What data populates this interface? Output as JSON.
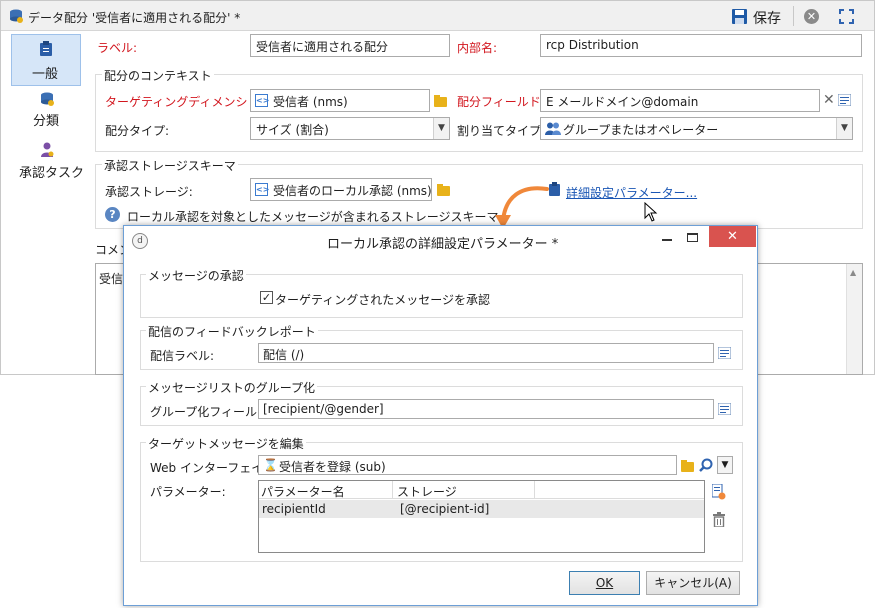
{
  "window": {
    "title": "データ配分 '受信者に適用される配分' *",
    "save_label": "保存",
    "close_icon": "close-circle-icon",
    "fullscreen_icon": "expand-icon"
  },
  "sidebar": {
    "items": [
      {
        "label": "一般",
        "icon": "clipboard-icon",
        "selected": true
      },
      {
        "label": "分類",
        "icon": "database-icon",
        "selected": false
      },
      {
        "label": "承認タスク",
        "icon": "person-icon",
        "selected": false
      }
    ]
  },
  "general": {
    "label_caption": "ラベル:",
    "label_value": "受信者に適用される配分",
    "internal_name_caption": "内部名:",
    "internal_name_value": "rcp Distribution"
  },
  "context": {
    "section_title": "配分のコンテキスト",
    "targeting_caption": "ターゲティングディメンション:",
    "targeting_value": "受信者 (nms)",
    "field_caption": "配分フィールド:",
    "field_value": "E メールドメイン@domain",
    "type_caption": "配分タイプ:",
    "type_value": "サイズ (割合)",
    "assignment_caption": "割り当てタイプ:",
    "assignment_value": "グループまたはオペレーター"
  },
  "storage": {
    "section_title": "承認ストレージスキーマ",
    "storage_caption": "承認ストレージ:",
    "storage_value": "受信者のローカル承認 (nms)",
    "advanced_link": "詳細設定パラメーター...",
    "help_text": "ローカル承認を対象としたメッセージが含まれるストレージスキーマ"
  },
  "comment": {
    "caption": "コメン",
    "value": "受信"
  },
  "dialog": {
    "title": "ローカル承認の詳細設定パラメーター *",
    "approval": {
      "section_title": "メッセージの承認",
      "checkbox_label": "ターゲティングされたメッセージを承認",
      "checked": true
    },
    "feedback": {
      "section_title": "配信のフィードバックレポート",
      "caption": "配信ラベル:",
      "value": "配信 (/)"
    },
    "grouping": {
      "section_title": "メッセージリストのグループ化",
      "caption": "グループ化フィールド:",
      "value": "[recipient/@gender]"
    },
    "edit": {
      "section_title": "ターゲットメッセージを編集",
      "web_caption": "Web インターフェイス:",
      "web_value": "受信者を登録 (sub)",
      "params_caption": "パラメーター:",
      "columns": [
        "パラメーター名",
        "ストレージ"
      ],
      "rows": [
        [
          "recipientId",
          "[@recipient-id]"
        ]
      ]
    },
    "ok_label": "OK",
    "cancel_label": "キャンセル(A)"
  },
  "colors": {
    "required_label": "#d2161e",
    "link": "#1a56b4",
    "accent_arrow": "#f0883a",
    "dialog_border": "#6d9fd6",
    "close_button": "#d9534f"
  }
}
